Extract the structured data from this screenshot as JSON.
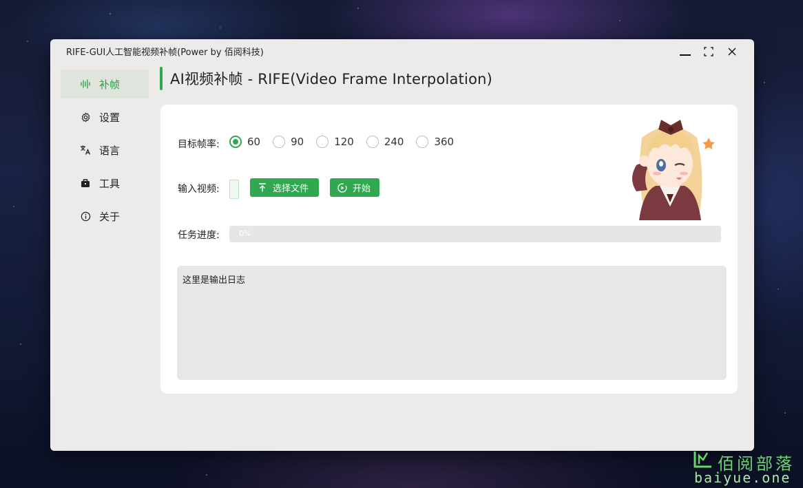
{
  "window": {
    "title": "RIFE-GUI人工智能视频补帧(Power by 佰阅科技)"
  },
  "sidebar": {
    "items": [
      {
        "label": "补帧",
        "icon": "waveform-icon",
        "active": true
      },
      {
        "label": "设置",
        "icon": "gear-icon",
        "active": false
      },
      {
        "label": "语言",
        "icon": "translate-icon",
        "active": false
      },
      {
        "label": "工具",
        "icon": "toolbox-icon",
        "active": false
      },
      {
        "label": "关于",
        "icon": "info-icon",
        "active": false
      }
    ]
  },
  "page": {
    "title": "AI视频补帧 - RIFE(Video Frame Interpolation)"
  },
  "form": {
    "fps_label": "目标帧率:",
    "fps_options": [
      "60",
      "90",
      "120",
      "240",
      "360"
    ],
    "fps_selected": "60",
    "input_label": "输入视频:",
    "choose_file_label": "选择文件",
    "start_label": "开始",
    "progress_label": "任务进度:",
    "progress_value": 0,
    "progress_text": "0%",
    "log_placeholder": "这里是输出日志"
  },
  "watermark": {
    "cn": "佰阅部落",
    "en": "baiyue.one"
  },
  "colors": {
    "accent": "#2fa84f",
    "window_bg": "#ecebea",
    "card_bg": "#ffffff"
  }
}
